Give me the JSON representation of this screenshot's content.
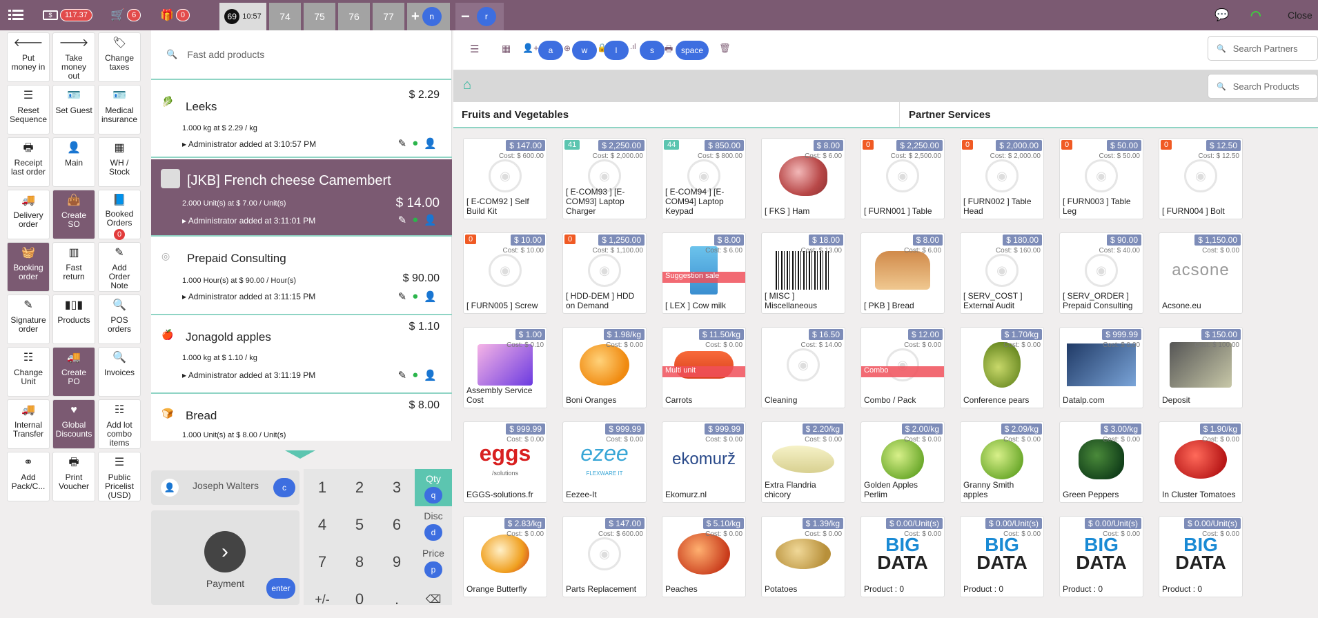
{
  "topbar": {
    "cash_badge": "117.37",
    "cart_badge": "6",
    "gift_badge": "0",
    "active_order_number": "69",
    "active_order_time": "10:57",
    "order_tabs": [
      "74",
      "75",
      "76",
      "77"
    ],
    "add_key": "n",
    "remove_key": "r",
    "close_label": "Close"
  },
  "controls": [
    {
      "label": "Put\nmoney in",
      "icon": "🡐"
    },
    {
      "label": "Take\nmoney\nout",
      "icon": "🡒"
    },
    {
      "label": "Change\ntaxes",
      "icon": "🏷"
    },
    {
      "label": "Reset\nSequence",
      "icon": "☰"
    },
    {
      "label": "Set Guest",
      "icon": "🪪"
    },
    {
      "label": "Medical\ninsurance",
      "icon": "🪪"
    },
    {
      "label": "Receipt\nlast order",
      "icon": "🖶"
    },
    {
      "label": "Main",
      "icon": "👤"
    },
    {
      "label": "WH /\nStock",
      "icon": "▦"
    },
    {
      "label": "Delivery\norder",
      "icon": "🚚"
    },
    {
      "label": "Create\nSO",
      "icon": "👜"
    },
    {
      "label": "Booked\nOrders",
      "icon": "📘",
      "badge": "0"
    },
    {
      "label": "Booking\norder",
      "icon": "🧺"
    },
    {
      "label": "Fast\nreturn",
      "icon": "▥"
    },
    {
      "label": "Add\nOrder\nNote",
      "icon": "✎"
    },
    {
      "label": "Signature\norder",
      "icon": "✎"
    },
    {
      "label": "Products",
      "icon": "▮▯▮"
    },
    {
      "label": "POS\norders",
      "icon": "🔍"
    },
    {
      "label": "Change\nUnit",
      "icon": "☷"
    },
    {
      "label": "Create\nPO",
      "icon": "🚚"
    },
    {
      "label": "Invoices",
      "icon": "🔍"
    },
    {
      "label": "Internal\nTransfer",
      "icon": "🚚"
    },
    {
      "label": "Global\nDiscounts",
      "icon": "♥"
    },
    {
      "label": "Add lot\ncombo\nitems",
      "icon": "☷"
    },
    {
      "label": "Add\nPack/C...",
      "icon": "⚭"
    },
    {
      "label": "Print\nVoucher",
      "icon": "🖶"
    },
    {
      "label": "Public\nPricelist\n(USD)",
      "icon": "☰"
    }
  ],
  "order": {
    "fast_add_placeholder": "Fast add products",
    "lines": [
      {
        "name": "Leeks",
        "price": "$ 2.29",
        "qty": "1.000 kg at $ 2.29 / kg",
        "note": "Administrator added at 3:10:57 PM"
      },
      {
        "name": "[JKB] French cheese Camembert",
        "price": "$ 14.00",
        "qty": "2.000 Unit(s) at $ 7.00 / Unit(s)",
        "note": "Administrator added at 3:11:01 PM"
      },
      {
        "name": "Prepaid Consulting",
        "price": "$ 90.00",
        "qty": "1.000 Hour(s) at $ 90.00 / Hour(s)",
        "note": "Administrator added at 3:11:15 PM"
      },
      {
        "name": "Jonagold apples",
        "price": "$ 1.10",
        "qty": "1.000 kg at $ 1.10 / kg",
        "note": "Administrator added at 3:11:19 PM"
      },
      {
        "name": "Bread",
        "price": "$ 8.00",
        "qty": "1.000 Unit(s) at $ 8.00 / Unit(s)",
        "note": ""
      }
    ],
    "customer_name": "Joseph Walters",
    "customer_key": "c",
    "payment_label": "Payment",
    "payment_key": "enter"
  },
  "numpad": {
    "keys": [
      "1",
      "2",
      "3",
      "4",
      "5",
      "6",
      "7",
      "8",
      "9",
      "+/-",
      "0",
      "."
    ],
    "modes": [
      {
        "label": "Qty",
        "key": "q"
      },
      {
        "label": "Disc",
        "key": "d"
      },
      {
        "label": "Price",
        "key": "p"
      }
    ]
  },
  "products_header": {
    "shortcut_keys": [
      "a",
      "w",
      "l",
      "s",
      "space"
    ],
    "search_partners": "Search Partners",
    "search_products": "Search Products"
  },
  "categories": [
    "Fruits and Vegetables",
    "Partner Services"
  ],
  "products": [
    {
      "name": "[ E-COM92 ] Self Build Kit",
      "price": "$ 147.00",
      "cost": "Cost: $ 600.00",
      "stock": "",
      "img": "ph"
    },
    {
      "name": "[ E-COM93 ] [E-COM93] Laptop Charger",
      "price": "$ 2,250.00",
      "cost": "Cost: $ 2,000.00",
      "stock": "41",
      "img": "ph"
    },
    {
      "name": "[ E-COM94 ] [E-COM94] Laptop Keypad",
      "price": "$ 850.00",
      "cost": "Cost: $ 800.00",
      "stock": "44",
      "img": "ph"
    },
    {
      "name": "[ FKS ] Ham",
      "price": "$ 8.00",
      "cost": "Cost: $ 6.00",
      "stock": "",
      "img": "ham"
    },
    {
      "name": "[ FURN001 ] Table",
      "price": "$ 2,250.00",
      "cost": "Cost: $ 2,500.00",
      "stock": "0",
      "img": "ph"
    },
    {
      "name": "[ FURN002 ] Table Head",
      "price": "$ 2,000.00",
      "cost": "Cost: $ 2,000.00",
      "stock": "0",
      "img": "ph"
    },
    {
      "name": "[ FURN003 ] Table Leg",
      "price": "$ 50.00",
      "cost": "Cost: $ 50.00",
      "stock": "0",
      "img": "ph"
    },
    {
      "name": "[ FURN004 ] Bolt",
      "price": "$ 12.50",
      "cost": "Cost: $ 12.50",
      "stock": "0",
      "img": "ph"
    },
    {
      "name": "[ FURN005 ] Screw",
      "price": "$ 10.00",
      "cost": "Cost: $ 10.00",
      "stock": "0",
      "img": "ph"
    },
    {
      "name": "[ HDD-DEM ] HDD on Demand",
      "price": "$ 1,250.00",
      "cost": "Cost: $ 1,100.00",
      "stock": "0",
      "img": "ph"
    },
    {
      "name": "[ LEX ] Cow milk",
      "price": "$ 8.00",
      "cost": "Cost: $ 6.00",
      "stock": "",
      "img": "milk",
      "ribbon": "Suggestion sale"
    },
    {
      "name": "[ MISC ] Miscellaneous",
      "price": "$ 18.00",
      "cost": "Cost: $ 13.00",
      "stock": "",
      "img": "barcode"
    },
    {
      "name": "[ PKB ] Bread",
      "price": "$ 8.00",
      "cost": "Cost: $ 6.00",
      "stock": "",
      "img": "bread"
    },
    {
      "name": "[ SERV_COST ] External Audit",
      "price": "$ 180.00",
      "cost": "Cost: $ 160.00",
      "stock": "",
      "img": "ph"
    },
    {
      "name": "[ SERV_ORDER ] Prepaid Consulting",
      "price": "$ 90.00",
      "cost": "Cost: $ 40.00",
      "stock": "",
      "img": "ph"
    },
    {
      "name": "Acsone.eu",
      "price": "$ 1,150.00",
      "cost": "Cost: $ 0.00",
      "stock": "",
      "img": "acsone"
    },
    {
      "name": "Assembly Service Cost",
      "price": "$ 1.00",
      "cost": "Cost: $ 0.10",
      "stock": "",
      "img": "assembly"
    },
    {
      "name": "Boni Oranges",
      "price": "$ 1.98/kg",
      "cost": "Cost: $ 0.00",
      "stock": "",
      "img": "orange"
    },
    {
      "name": "Carrots",
      "price": "$ 11.50/kg",
      "cost": "Cost: $ 0.00",
      "stock": "",
      "img": "carrot",
      "ribbon": "Multi unit"
    },
    {
      "name": "Cleaning",
      "price": "$ 16.50",
      "cost": "Cost: $ 14.00",
      "stock": "",
      "img": "ph"
    },
    {
      "name": "Combo / Pack",
      "price": "$ 12.00",
      "cost": "Cost: $ 0.00",
      "stock": "",
      "img": "ph",
      "ribbon": "Combo"
    },
    {
      "name": "Conference pears",
      "price": "$ 1.70/kg",
      "cost": "Cost: $ 0.00",
      "stock": "",
      "img": "pear"
    },
    {
      "name": "Datalp.com",
      "price": "$ 999.99",
      "cost": "Cost: $ 0.00",
      "stock": "",
      "img": "datalp"
    },
    {
      "name": "Deposit",
      "price": "$ 150.00",
      "cost": "Cost: $ 100.00",
      "stock": "",
      "img": "deposit"
    },
    {
      "name": "EGGS-solutions.fr",
      "price": "$ 999.99",
      "cost": "Cost: $ 0.00",
      "stock": "",
      "img": "eggs"
    },
    {
      "name": "Eezee-It",
      "price": "$ 999.99",
      "cost": "Cost: $ 0.00",
      "stock": "",
      "img": "eezee"
    },
    {
      "name": "Ekomurz.nl",
      "price": "$ 999.99",
      "cost": "Cost: $ 0.00",
      "stock": "",
      "img": "ekomurz"
    },
    {
      "name": "Extra Flandria chicory",
      "price": "$ 2.20/kg",
      "cost": "Cost: $ 0.00",
      "stock": "",
      "img": "chicory"
    },
    {
      "name": "Golden Apples Perlim",
      "price": "$ 2.00/kg",
      "cost": "Cost: $ 0.00",
      "stock": "",
      "img": "apple"
    },
    {
      "name": "Granny Smith apples",
      "price": "$ 2.09/kg",
      "cost": "Cost: $ 0.00",
      "stock": "",
      "img": "apple"
    },
    {
      "name": "Green Peppers",
      "price": "$ 3.00/kg",
      "cost": "Cost: $ 0.00",
      "stock": "",
      "img": "pepper"
    },
    {
      "name": "In Cluster Tomatoes",
      "price": "$ 1.90/kg",
      "cost": "Cost: $ 0.00",
      "stock": "",
      "img": "tomato"
    },
    {
      "name": "Orange Butterfly",
      "price": "$ 2.83/kg",
      "cost": "Cost: $ 0.00",
      "stock": "",
      "img": "butterfly"
    },
    {
      "name": "Parts Replacement",
      "price": "$ 147.00",
      "cost": "Cost: $ 600.00",
      "stock": "",
      "img": "ph"
    },
    {
      "name": "Peaches",
      "price": "$ 5.10/kg",
      "cost": "Cost: $ 0.00",
      "stock": "",
      "img": "peach"
    },
    {
      "name": "Potatoes",
      "price": "$ 1.39/kg",
      "cost": "Cost: $ 0.00",
      "stock": "",
      "img": "potato"
    },
    {
      "name": "Product : 0",
      "price": "$ 0.00/Unit(s)",
      "cost": "Cost: $ 0.00",
      "stock": "",
      "img": "bigdata"
    },
    {
      "name": "Product : 0",
      "price": "$ 0.00/Unit(s)",
      "cost": "Cost: $ 0.00",
      "stock": "",
      "img": "bigdata"
    },
    {
      "name": "Product : 0",
      "price": "$ 0.00/Unit(s)",
      "cost": "Cost: $ 0.00",
      "stock": "",
      "img": "bigdata"
    },
    {
      "name": "Product : 0",
      "price": "$ 0.00/Unit(s)",
      "cost": "Cost: $ 0.00",
      "stock": "",
      "img": "bigdata"
    }
  ],
  "logo_text": {
    "bigdata_top": "BIG",
    "bigdata_bottom": "DATA",
    "acsone": "acsone",
    "eggs": "eggs",
    "eggs_sub": "/solutions",
    "eezee": "ezee",
    "eezee_sub": "FLEXWARE IT",
    "ekomurz": "ekomurž"
  }
}
